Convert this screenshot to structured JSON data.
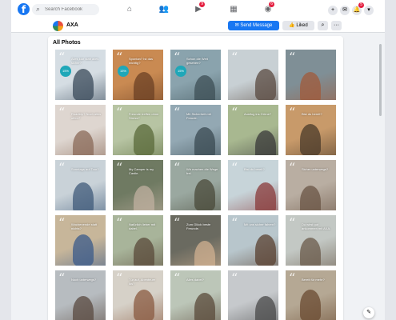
{
  "topnav": {
    "logo": "f",
    "search_placeholder": "Search Facebook",
    "tabs": [
      {
        "name": "home",
        "icon": "⌂",
        "badge": ""
      },
      {
        "name": "friends",
        "icon": "👥",
        "badge": ""
      },
      {
        "name": "watch",
        "icon": "▶",
        "badge": "9"
      },
      {
        "name": "marketplace",
        "icon": "▦",
        "badge": ""
      },
      {
        "name": "groups",
        "icon": "◉",
        "badge": "6"
      }
    ],
    "right": [
      {
        "name": "create",
        "icon": "+",
        "badge": ""
      },
      {
        "name": "messenger",
        "icon": "✉",
        "badge": ""
      },
      {
        "name": "notifications",
        "icon": "🔔",
        "badge": "5"
      },
      {
        "name": "account",
        "icon": "▾",
        "badge": ""
      }
    ]
  },
  "page": {
    "name": "AXA",
    "send_message": "Send Message",
    "liked": "Liked",
    "search_icon": "⌕",
    "more_icon": "···"
  },
  "photos": {
    "title": "All Photos",
    "items": [
      {
        "caption": "Alles klar statt alles sicher?",
        "bg": "#d5dde3",
        "fg": "#3a4a5a",
        "badge": "15%"
      },
      {
        "caption": "Spontan? Ist das wichtig?",
        "bg": "#c98a52",
        "fg": "#6b4024",
        "badge": "15%"
      },
      {
        "caption": "Schon die Welt gesehen?",
        "bg": "#8aa3ad",
        "fg": "#3d4f55",
        "badge": "15%"
      },
      {
        "caption": "",
        "bg": "#c8d0d4",
        "fg": "#5a4a40",
        "badge": ""
      },
      {
        "caption": "",
        "bg": "#7f8f96",
        "fg": "#a05a3a",
        "badge": ""
      },
      {
        "caption": "Roadtrip? Noch alles offen?",
        "bg": "#ded6d0",
        "fg": "#8a6a58",
        "badge": ""
      },
      {
        "caption": "Freunde treffen ohne Stress?",
        "bg": "#b7c4a3",
        "fg": "#5a6a3a",
        "badge": ""
      },
      {
        "caption": "Mit Sicherheit mit Freude.",
        "bg": "#93a8b3",
        "fg": "#3a4a52",
        "badge": ""
      },
      {
        "caption": "Ausflug ins Grüne?",
        "bg": "#a8b890",
        "fg": "#3a3a3a",
        "badge": ""
      },
      {
        "caption": "Bist du bereit?",
        "bg": "#c89a6a",
        "fg": "#4a3a2a",
        "badge": ""
      },
      {
        "caption": "Sonntags auf Tour?",
        "bg": "#c9d2d8",
        "fg": "#3f5a7a",
        "badge": ""
      },
      {
        "caption": "My Camper is my Castle.",
        "bg": "#6f7a62",
        "fg": "#c0b0a0",
        "badge": ""
      },
      {
        "caption": "Wir machen die Wege frei.",
        "bg": "#9aa8a0",
        "fg": "#4a4a3a",
        "badge": ""
      },
      {
        "caption": "Bist du bereit?",
        "bg": "#c7d4d9",
        "fg": "#8a3a3a",
        "badge": ""
      },
      {
        "caption": "Sicher unterwegs?",
        "bg": "#b9aea2",
        "fg": "#6a5444",
        "badge": ""
      },
      {
        "caption": "Wochenende statt nichts?",
        "bg": "#c7b69a",
        "fg": "#3a5a8a",
        "badge": ""
      },
      {
        "caption": "Natürlich lieber mit dabei.",
        "bg": "#a8b49a",
        "fg": "#5a4a3a",
        "badge": ""
      },
      {
        "caption": "Zum Glück beste Freunde.",
        "bg": "#6a6a60",
        "fg": "#d0b090",
        "badge": ""
      },
      {
        "caption": "Mit uns sicher fahren?",
        "bg": "#b8c6cc",
        "fg": "#5a4030",
        "badge": ""
      },
      {
        "caption": "Du wirst gut ankommen mit AXA.",
        "bg": "#c3c8c4",
        "fg": "#6a5a4a",
        "badge": ""
      },
      {
        "caption": "Noch unterwegs?",
        "bg": "#b7bcc0",
        "fg": "#5a4a40",
        "badge": ""
      },
      {
        "caption": "Tür auf, Abenteuer los?",
        "bg": "#d6d1c8",
        "fg": "#8a5a40",
        "badge": ""
      },
      {
        "caption": "Alles dabei?",
        "bg": "#bcc6b8",
        "fg": "#5a4a3a",
        "badge": ""
      },
      {
        "caption": "",
        "bg": "#c6c9cc",
        "fg": "#4a4a4a",
        "badge": ""
      },
      {
        "caption": "Bereit für mehr?",
        "bg": "#b5a894",
        "fg": "#6a4a30",
        "badge": ""
      }
    ]
  },
  "fab_icon": "✎"
}
